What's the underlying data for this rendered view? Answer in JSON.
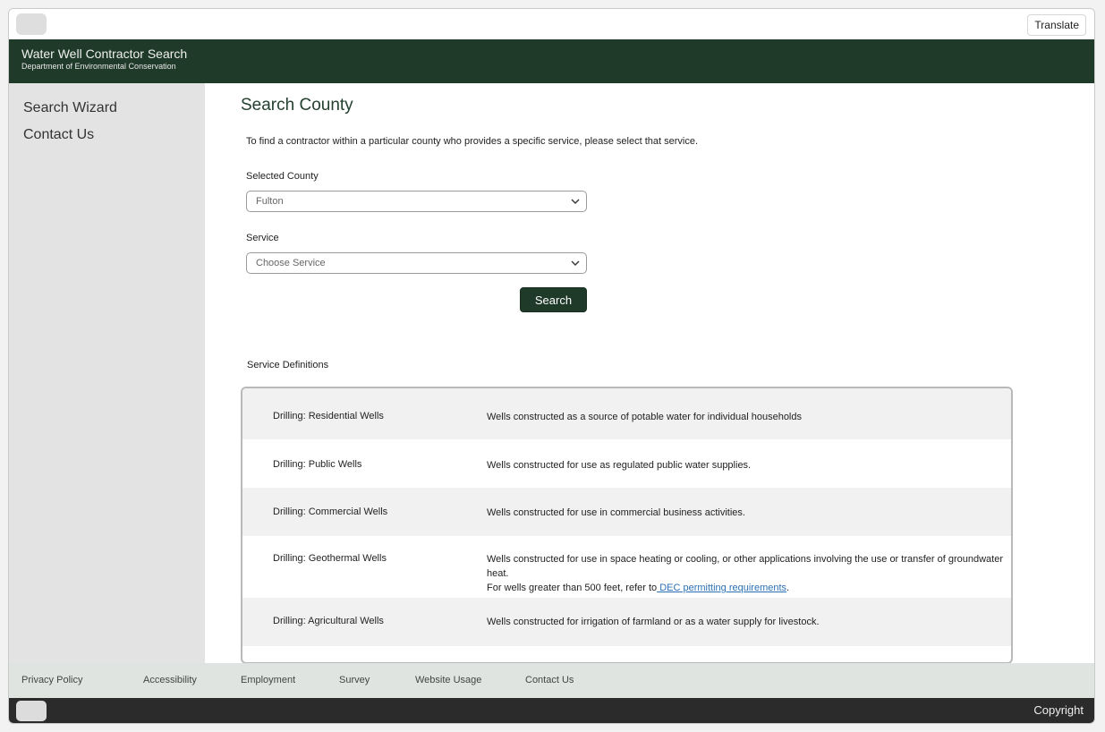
{
  "topbar": {
    "translate_label": "Translate"
  },
  "header": {
    "title": "Water Well Contractor Search",
    "subtitle": "Department of Environmental Conservation"
  },
  "sidebar": {
    "items": [
      {
        "label": "Search Wizard"
      },
      {
        "label": "Contact Us"
      }
    ]
  },
  "main": {
    "title": "Search County",
    "intro": "To find a contractor within a particular county who provides a specific service, please select that service.",
    "county_label": "Selected County",
    "county_value": "Fulton",
    "service_label": "Service",
    "service_placeholder": "Choose Service",
    "search_label": "Search",
    "definitions_heading": "Service Definitions",
    "definitions": [
      {
        "name": "Drilling: Residential Wells",
        "text": "Wells constructed as a source of potable water for individual households"
      },
      {
        "name": "Drilling: Public Wells",
        "text": "Wells constructed for use as regulated public water supplies."
      },
      {
        "name": "Drilling: Commercial Wells",
        "text": "Wells constructed for use in commercial business activities."
      },
      {
        "name": "Drilling: Geothermal Wells",
        "text": "Wells constructed for use in space heating or cooling, or other applications involving the use or transfer of groundwater heat.",
        "text2": "For wells greater than 500 feet, refer to",
        "link": " DEC permitting requirements",
        "text3": "."
      },
      {
        "name": "Drilling: Agricultural Wells",
        "text": "Wells constructed for irrigation of farmland or as a water supply for livestock."
      }
    ]
  },
  "footer": {
    "links": [
      {
        "label": "Privacy Policy"
      },
      {
        "label": "Accessibility"
      },
      {
        "label": "Employment"
      },
      {
        "label": "Survey"
      },
      {
        "label": "Website Usage"
      },
      {
        "label": "Contact Us"
      }
    ],
    "copyright": "Copyright"
  },
  "colors": {
    "brand_green": "#203a2a",
    "link_blue": "#2a6fb5",
    "footer_dark": "#2b2b2b",
    "footer_light": "#dfe4e0"
  }
}
